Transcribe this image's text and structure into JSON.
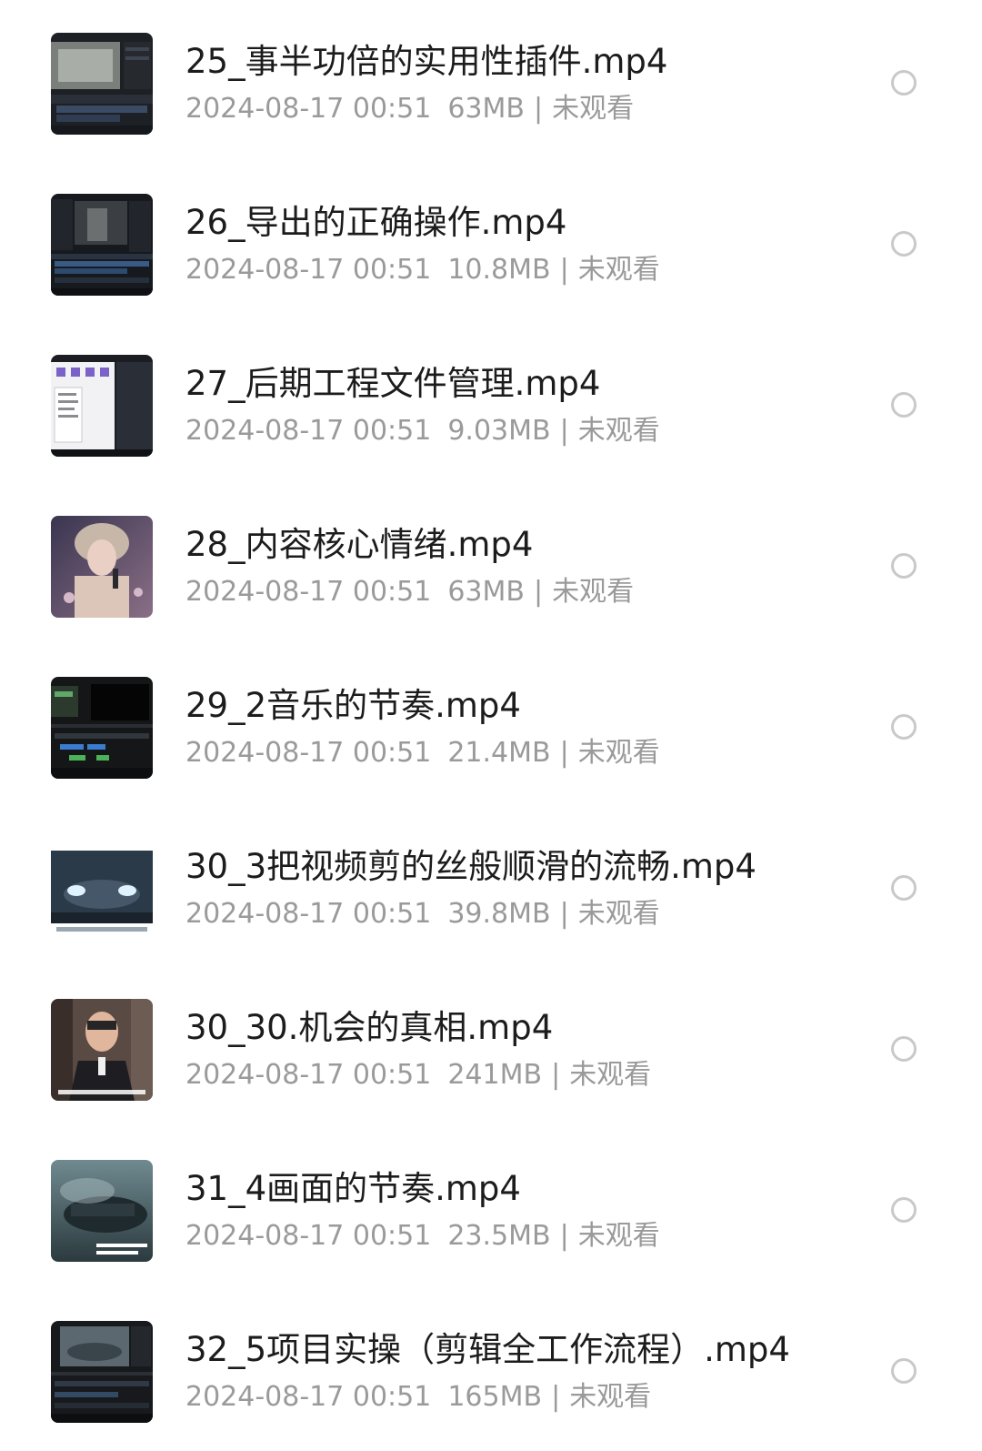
{
  "files": [
    {
      "name": "25_事半功倍的实用性插件.mp4",
      "date": "2024-08-17 00:51",
      "size": "63MB",
      "status": "未观看",
      "thumb_icon": "editor-screenshot-thumbnail"
    },
    {
      "name": "26_导出的正确操作.mp4",
      "date": "2024-08-17 00:51",
      "size": "10.8MB",
      "status": "未观看",
      "thumb_icon": "editor-screenshot-thumbnail"
    },
    {
      "name": "27_后期工程文件管理.mp4",
      "date": "2024-08-17 00:51",
      "size": "9.03MB",
      "status": "未观看",
      "thumb_icon": "file-manager-thumbnail"
    },
    {
      "name": "28_内容核心情绪.mp4",
      "date": "2024-08-17 00:51",
      "size": "63MB",
      "status": "未观看",
      "thumb_icon": "singer-thumbnail"
    },
    {
      "name": "29_2音乐的节奏.mp4",
      "date": "2024-08-17 00:51",
      "size": "21.4MB",
      "status": "未观看",
      "thumb_icon": "timeline-thumbnail"
    },
    {
      "name": "30_3把视频剪的丝般顺滑的流畅.mp4",
      "date": "2024-08-17 00:51",
      "size": "39.8MB",
      "status": "未观看",
      "thumb_icon": "car-headlights-thumbnail"
    },
    {
      "name": "30_30.机会的真相.mp4",
      "date": "2024-08-17 00:51",
      "size": "241MB",
      "status": "未观看",
      "thumb_icon": "speaker-thumbnail"
    },
    {
      "name": "31_4画面的节奏.mp4",
      "date": "2024-08-17 00:51",
      "size": "23.5MB",
      "status": "未观看",
      "thumb_icon": "foggy-car-thumbnail"
    },
    {
      "name": "32_5项目实操（剪辑全工作流程）.mp4",
      "date": "2024-08-17 00:51",
      "size": "165MB",
      "status": "未观看",
      "thumb_icon": "car-editor-thumbnail"
    }
  ],
  "separator": "|",
  "colors": {
    "title": "#1c1c1c",
    "meta": "#9a9a9a",
    "radio_border": "#c9c9c9",
    "background": "#ffffff"
  }
}
